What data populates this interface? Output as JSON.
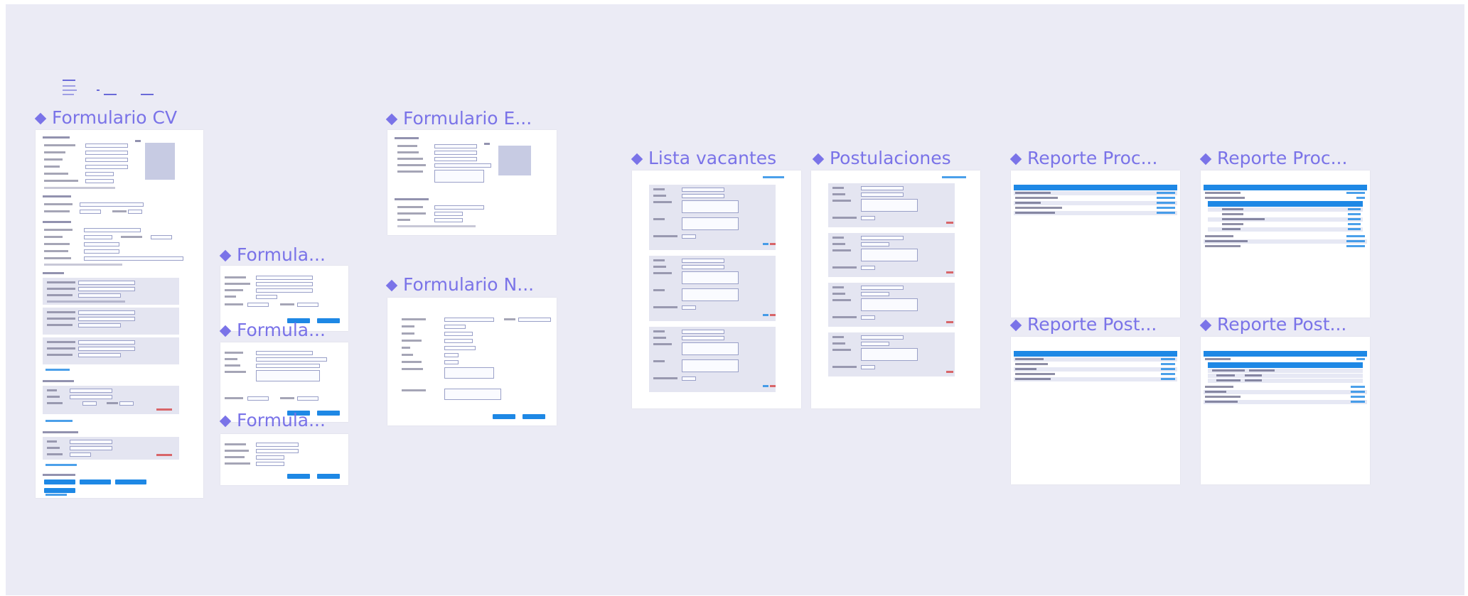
{
  "frames": {
    "formulario_cv": "Formulario CV",
    "formulario_e": "Formulario E...",
    "formulario_1": "Formula...",
    "formulario_2": "Formula...",
    "formulario_3": "Formula...",
    "formulario_n": "Formulario N...",
    "lista_vacantes": "Lista vacantes",
    "postulaciones": "Postulaciones",
    "reporte_proc_1": "Reporte Proc...",
    "reporte_proc_2": "Reporte Proc...",
    "reporte_post_1": "Reporte Post...",
    "reporte_post_2": "Reporte Post..."
  },
  "colors": {
    "canvas": "#ebebf5",
    "frame_title": "#7a73e8",
    "accent": "#1e88e5",
    "danger": "#d32f2f"
  },
  "icons": {
    "component": "component-diamond-icon"
  }
}
